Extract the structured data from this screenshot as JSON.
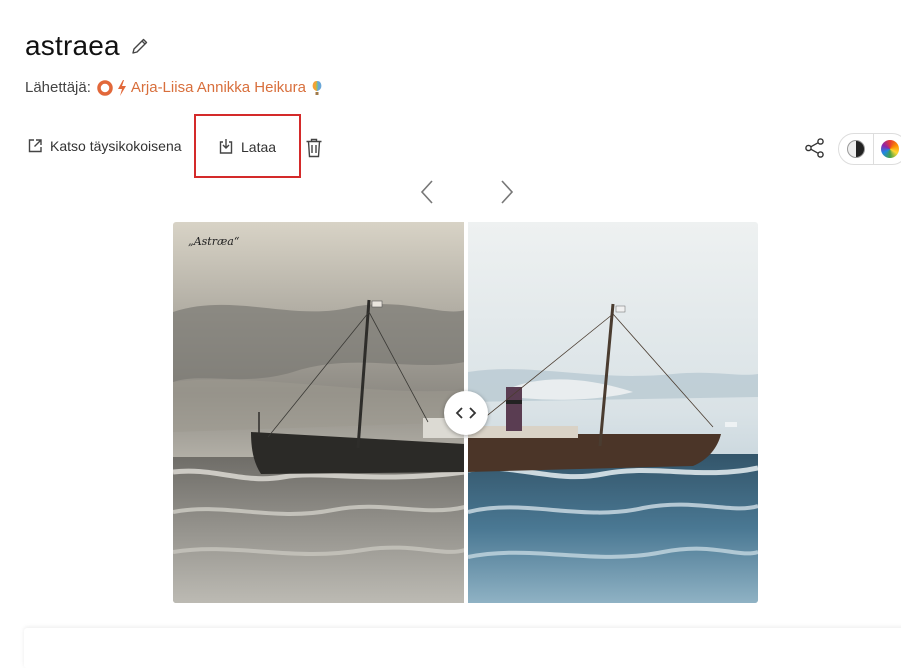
{
  "photo": {
    "title": "astraea",
    "uploader_label": "Lähettäjä:",
    "uploader_name": "Arja-Liisa Annikka Heikura",
    "caption_in_photo": "„Astræa“"
  },
  "toolbar": {
    "fullsize_label": "Katso täysikokoisena",
    "download_label": "Lataa"
  },
  "icons": {
    "edit": "pencil-icon",
    "fullsize": "external-link-icon",
    "download": "download-icon",
    "delete": "trash-icon",
    "share": "share-icon",
    "prev": "chevron-left-icon",
    "next": "chevron-right-icon",
    "compare": "compare-arrows-icon"
  },
  "colors": {
    "accent": "#d86f3c",
    "highlight": "#d42a2a"
  }
}
